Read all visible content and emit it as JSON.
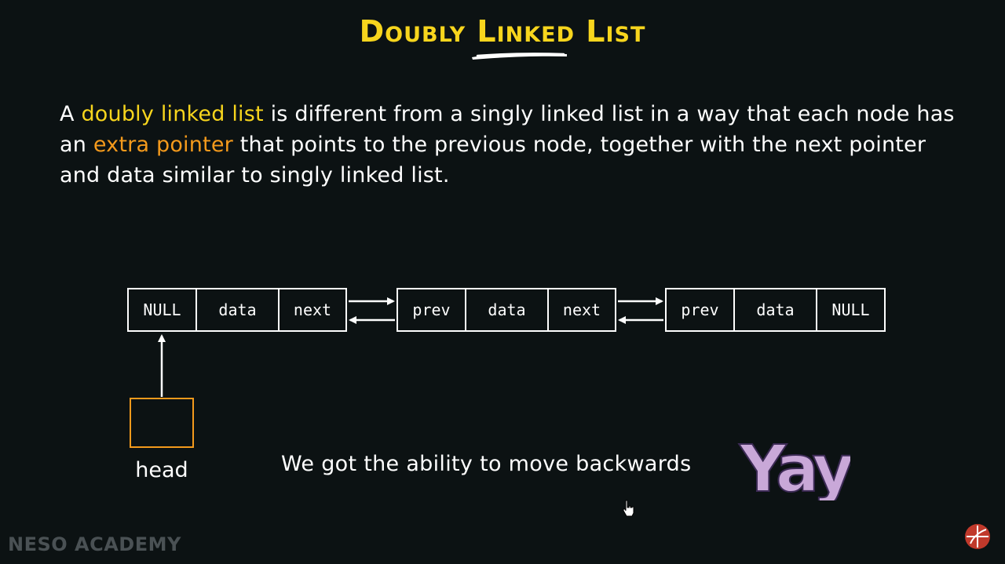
{
  "title": "Doubly Linked List",
  "paragraph": {
    "p1": "A ",
    "h1": "doubly linked list",
    "p2": " is different from a singly linked list in a way that each node has an ",
    "h2": "extra pointer",
    "p3": " that points to the previous node, together with the next pointer and data similar to singly linked list."
  },
  "nodes": [
    {
      "cells": [
        "NULL",
        "data",
        "next"
      ]
    },
    {
      "cells": [
        "prev",
        "data",
        "next"
      ]
    },
    {
      "cells": [
        "prev",
        "data",
        "NULL"
      ]
    }
  ],
  "head_label": "head",
  "caption": "We got the ability to move backwards",
  "exclamation": "Yay!",
  "watermark": "NESO ACADEMY",
  "colors": {
    "background": "#0c1213",
    "title": "#f7d51d",
    "highlight_yellow": "#f7d51d",
    "highlight_orange": "#f49a1c",
    "head_box": "#f49a1c",
    "logo": "#c0392b"
  },
  "icons": {
    "cursor": "hand-pointer-icon",
    "logo": "neso-logo-icon"
  }
}
